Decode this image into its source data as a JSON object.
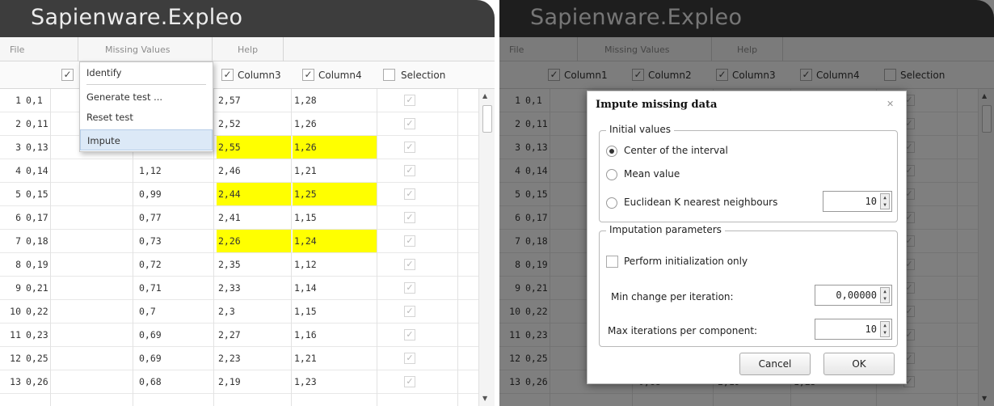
{
  "app": {
    "title": "Sapienware.Expleo"
  },
  "menu": {
    "file": "File",
    "missing_values": "Missing Values",
    "help": "Help"
  },
  "columns": {
    "col3": "Column3",
    "col4": "Column4",
    "selection": "Selection",
    "right_col1": "Column1",
    "right_col2": "Column2",
    "right_col3": "Column3",
    "right_col4": "Column4",
    "right_selection": "Selection"
  },
  "dropdown": {
    "items": [
      "Identify",
      "Generate test ...",
      "Reset test",
      "Impute"
    ]
  },
  "rows": [
    {
      "n": "1",
      "c1": "0,1",
      "c2": "",
      "c3": "2,57",
      "c4": "1,28",
      "hl": false
    },
    {
      "n": "2",
      "c1": "0,11",
      "c2": "",
      "c3": "2,52",
      "c4": "1,26",
      "hl": false
    },
    {
      "n": "3",
      "c1": "0,13",
      "c2": "",
      "c3": "2,55",
      "c4": "1,26",
      "hl": true
    },
    {
      "n": "4",
      "c1": "0,14",
      "c2": "1,12",
      "c3": "2,46",
      "c4": "1,21",
      "hl": false
    },
    {
      "n": "5",
      "c1": "0,15",
      "c2": "0,99",
      "c3": "2,44",
      "c4": "1,25",
      "hl": true
    },
    {
      "n": "6",
      "c1": "0,17",
      "c2": "0,77",
      "c3": "2,41",
      "c4": "1,15",
      "hl": false
    },
    {
      "n": "7",
      "c1": "0,18",
      "c2": "0,73",
      "c3": "2,26",
      "c4": "1,24",
      "hl": true
    },
    {
      "n": "8",
      "c1": "0,19",
      "c2": "0,72",
      "c3": "2,35",
      "c4": "1,12",
      "hl": false
    },
    {
      "n": "9",
      "c1": "0,21",
      "c2": "0,71",
      "c3": "2,33",
      "c4": "1,14",
      "hl": false
    },
    {
      "n": "10",
      "c1": "0,22",
      "c2": "0,7",
      "c3": "2,3",
      "c4": "1,15",
      "hl": false
    },
    {
      "n": "11",
      "c1": "0,23",
      "c2": "0,69",
      "c3": "2,27",
      "c4": "1,16",
      "hl": false
    },
    {
      "n": "12",
      "c1": "0,25",
      "c2": "0,69",
      "c3": "2,23",
      "c4": "1,21",
      "hl": false
    },
    {
      "n": "13",
      "c1": "0,26",
      "c2": "0,68",
      "c3": "2,19",
      "c4": "1,23",
      "hl": false
    }
  ],
  "dialog": {
    "title": "Impute missing data",
    "close": "✕",
    "group1": "Initial values",
    "opt_center": "Center of the interval",
    "opt_mean": "Mean value",
    "opt_knn": "Euclidean K nearest neighbours",
    "knn_value": "10",
    "group2": "Imputation parameters",
    "perform_init": "Perform initialization only",
    "min_change_label": "Min change per iteration:",
    "min_change_value": "0,00000",
    "max_iter_label": "Max iterations per component:",
    "max_iter_value": "10",
    "cancel": "Cancel",
    "ok": "OK"
  }
}
